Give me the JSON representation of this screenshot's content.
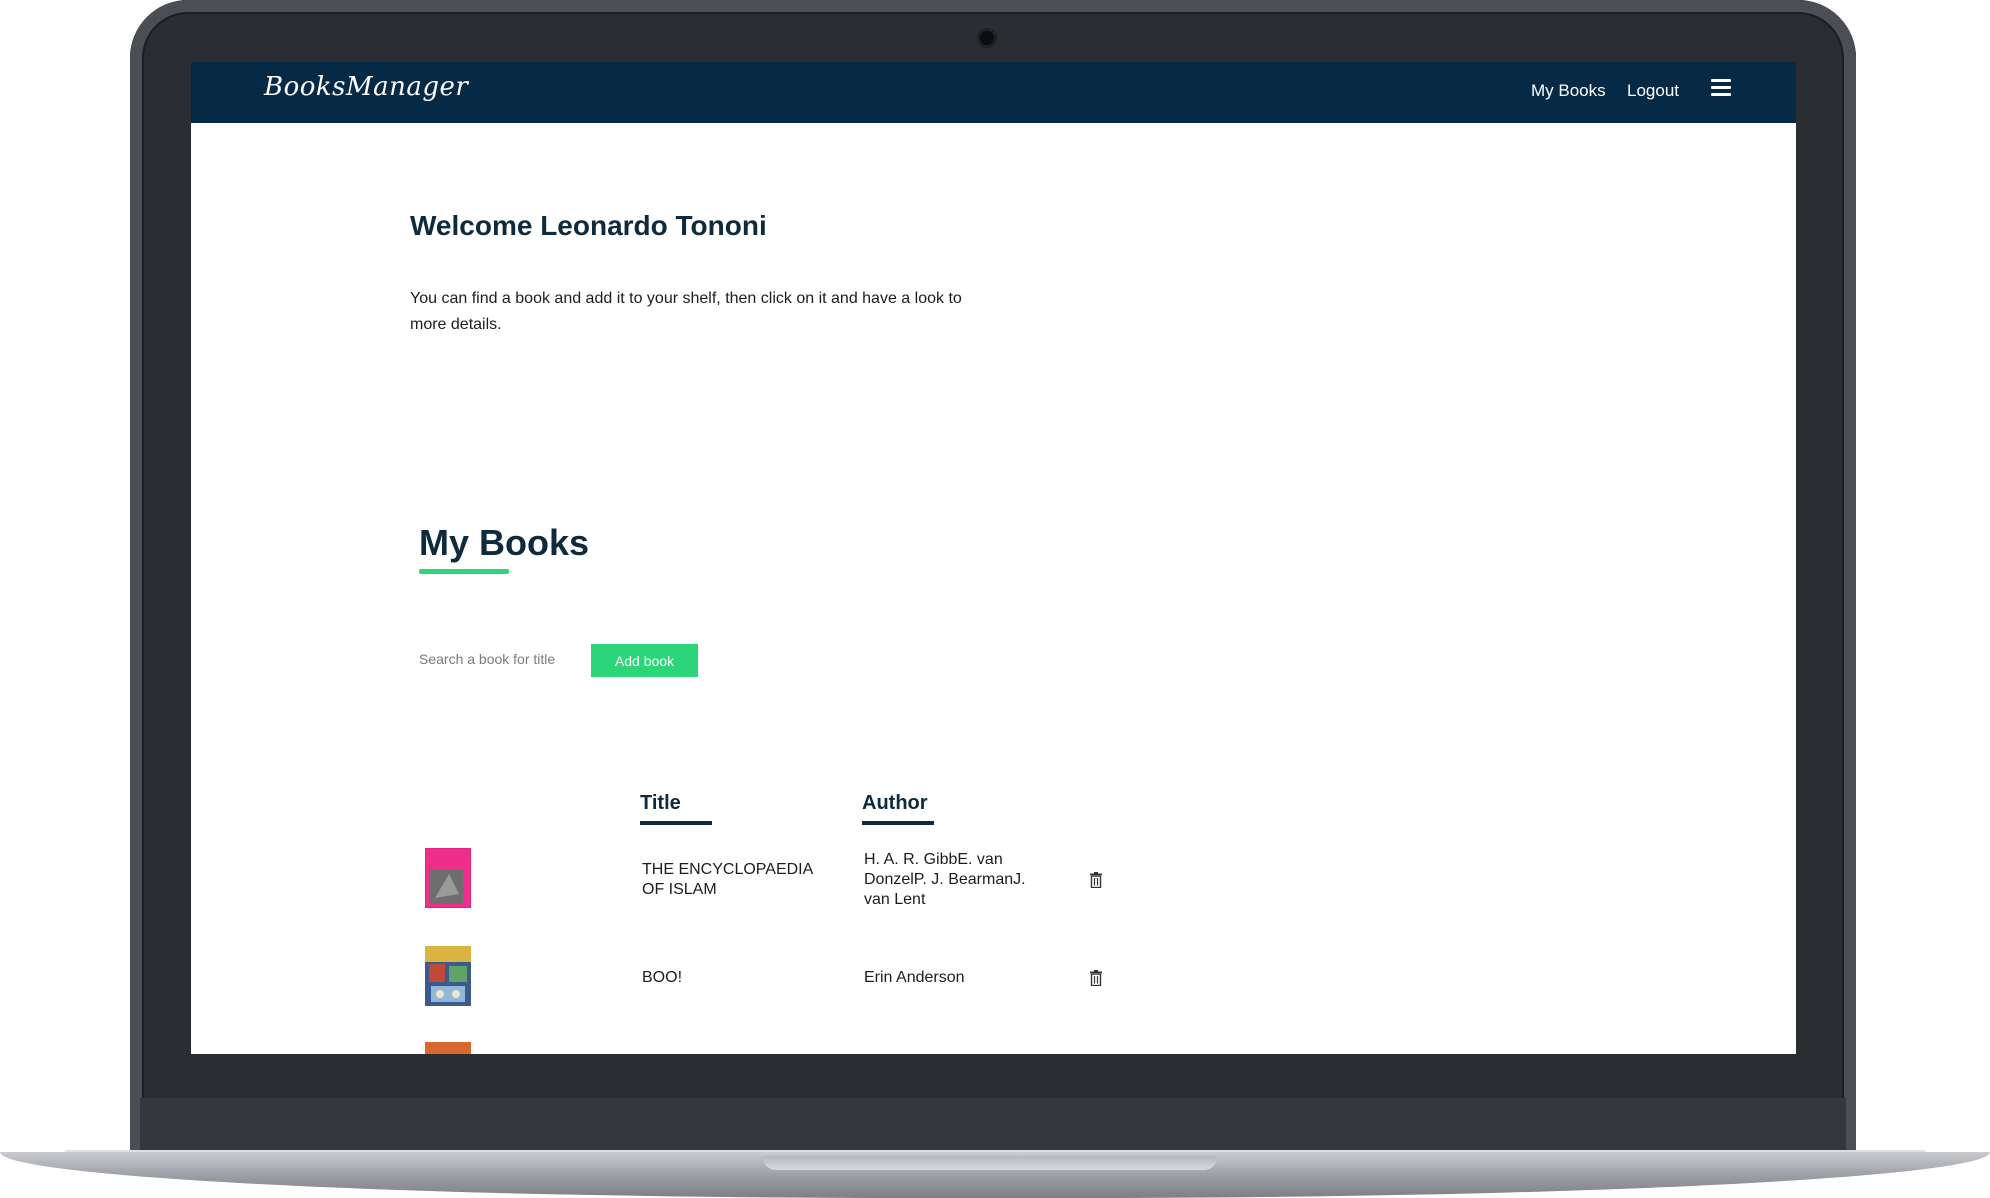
{
  "navbar": {
    "brand": "BooksManager",
    "links": [
      "My Books",
      "Logout"
    ],
    "menu_icon": "hamburger-menu-icon"
  },
  "welcome": {
    "title": "Welcome Leonardo Tononi",
    "text": "You can find a book and add it to your shelf, then click on it and have a look to more details."
  },
  "my_books": {
    "title": "My Books",
    "search_placeholder": "Search a book for title",
    "add_button": "Add book",
    "columns": [
      "Title",
      "Author"
    ],
    "rows": [
      {
        "title": "THE ENCYCLOPAEDIA OF ISLAM",
        "author": "H. A. R. GibbE. van DonzelP. J. BearmanJ. van Lent",
        "cover_colors": [
          "#ef2d8a",
          "#6e6e6e"
        ]
      },
      {
        "title": "BOO!",
        "author": "Erin Anderson",
        "cover_colors": [
          "#3d5a8c",
          "#d9b544"
        ]
      }
    ]
  },
  "colors": {
    "navbar": "#062a45",
    "accent": "#2dd57a",
    "heading": "#0f2a3d"
  }
}
